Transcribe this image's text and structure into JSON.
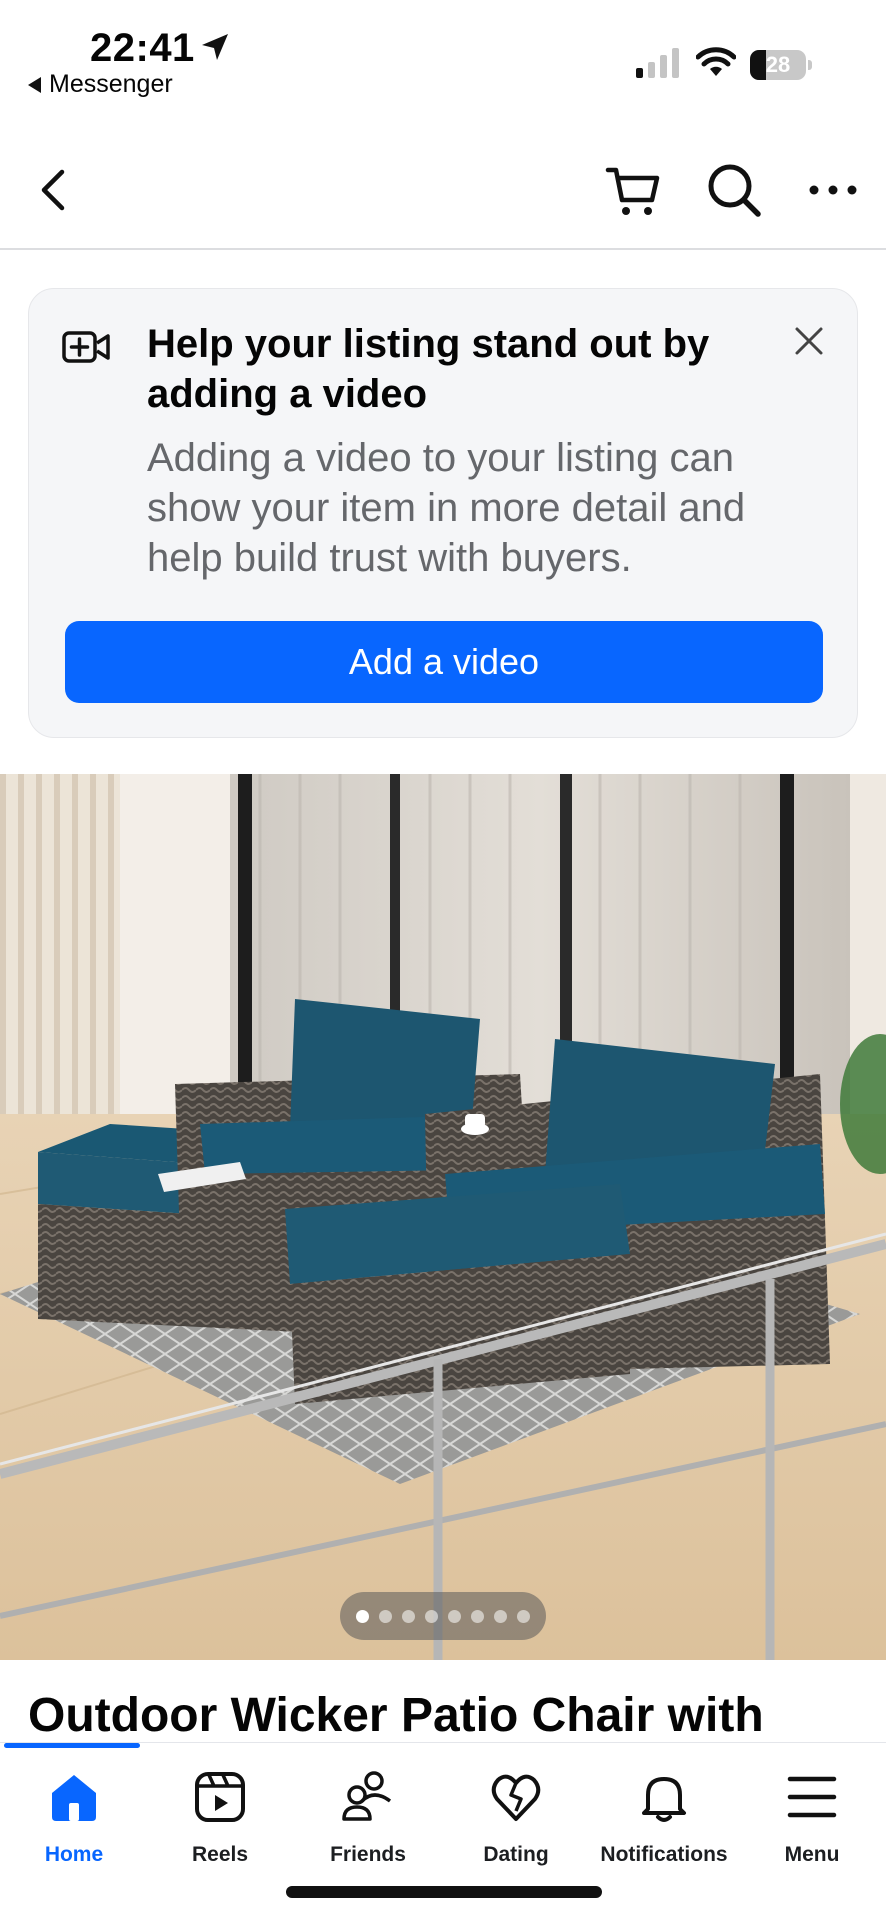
{
  "status_bar": {
    "time": "22:41",
    "back_app": "Messenger",
    "battery": "28",
    "icons": [
      "location-arrow-icon",
      "cellular-signal-icon",
      "wifi-icon",
      "battery-icon"
    ]
  },
  "top_nav": {
    "icons": [
      "back-chevron-icon",
      "cart-icon",
      "search-icon",
      "more-icon"
    ]
  },
  "promo_card": {
    "icon": "video-add-icon",
    "title": "Help your listing stand out by adding a video",
    "description": "Adding a video to your listing can show your item in more detail and help build trust with buyers.",
    "button_label": "Add a video",
    "close_icon": "close-icon",
    "accent_color": "#0866ff"
  },
  "listing": {
    "photo_count": 8,
    "active_photo": 1,
    "title": "Outdoor Wicker Patio Chair with"
  },
  "tab_bar": {
    "tabs": [
      {
        "label": "Home",
        "icon": "home-icon",
        "active": true
      },
      {
        "label": "Reels",
        "icon": "reels-icon",
        "active": false
      },
      {
        "label": "Friends",
        "icon": "friends-icon",
        "active": false
      },
      {
        "label": "Dating",
        "icon": "dating-icon",
        "active": false
      },
      {
        "label": "Notifications",
        "icon": "bell-icon",
        "active": false
      },
      {
        "label": "Menu",
        "icon": "menu-icon",
        "active": false
      }
    ]
  }
}
